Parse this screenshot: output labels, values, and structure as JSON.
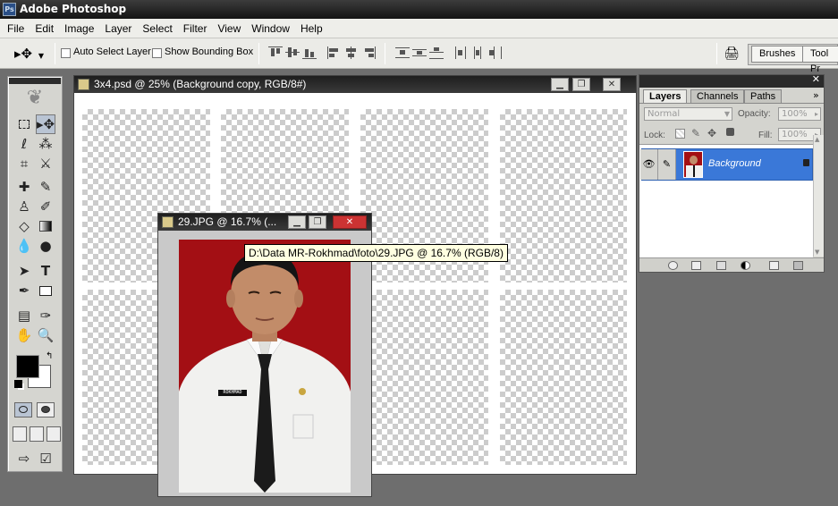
{
  "app": {
    "title": "Adobe Photoshop",
    "icon": "photoshop-app-icon"
  },
  "menu": [
    "File",
    "Edit",
    "Image",
    "Layer",
    "Select",
    "Filter",
    "View",
    "Window",
    "Help"
  ],
  "options": {
    "auto_select_label": "Auto Select Layer",
    "auto_select_checked": false,
    "bounding_box_label": "Show Bounding Box",
    "bounding_box_checked": false
  },
  "palette_well": {
    "tabs": [
      "Brushes",
      "Tool Pr"
    ]
  },
  "documents": [
    {
      "title": "3x4.psd @ 25% (Background copy, RGB/8#)"
    },
    {
      "title": "29.JPG @ 16.7% (..."
    }
  ],
  "tooltip": "D:\\Data MR-Rokhmad\\foto\\29.JPG @ 16.7% (RGB/8)",
  "layers_panel": {
    "tabs": [
      "Layers",
      "Channels",
      "Paths"
    ],
    "active_tab": "Layers",
    "blend_mode": "Normal",
    "opacity_label": "Opacity:",
    "opacity": "100%",
    "lock_label": "Lock:",
    "fill_label": "Fill:",
    "fill": "100%",
    "layers": [
      {
        "name": "Background",
        "visible": true,
        "locked": true
      }
    ]
  },
  "photo": {
    "name_tag": "ROKHMAD"
  },
  "colors": {
    "accent_selection": "#3a78d8",
    "photo_background": "#a30f14",
    "foreground": "#000000",
    "background": "#ffffff"
  }
}
